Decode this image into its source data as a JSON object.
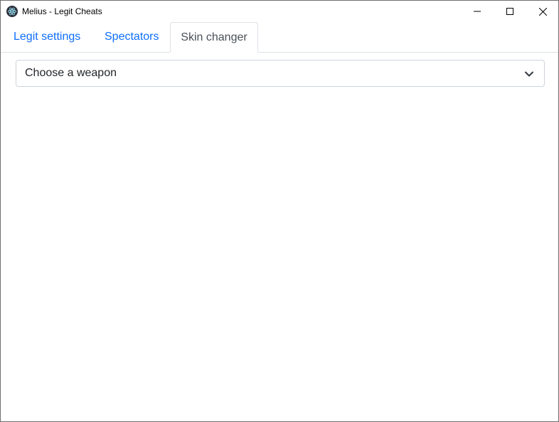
{
  "window": {
    "title": "Melius - Legit Cheats"
  },
  "tabs": [
    {
      "label": "Legit settings",
      "active": false
    },
    {
      "label": "Spectators",
      "active": false
    },
    {
      "label": "Skin changer",
      "active": true
    }
  ],
  "weapon_select": {
    "selected": "Choose a weapon"
  },
  "colors": {
    "link": "#0d6efd",
    "active_tab_text": "#495057",
    "border": "#dee2e6"
  },
  "icons": {
    "app": "electron-atom-icon",
    "minimize": "minimize-icon",
    "maximize": "maximize-icon",
    "close": "close-icon",
    "select_caret": "chevron-down-icon"
  }
}
